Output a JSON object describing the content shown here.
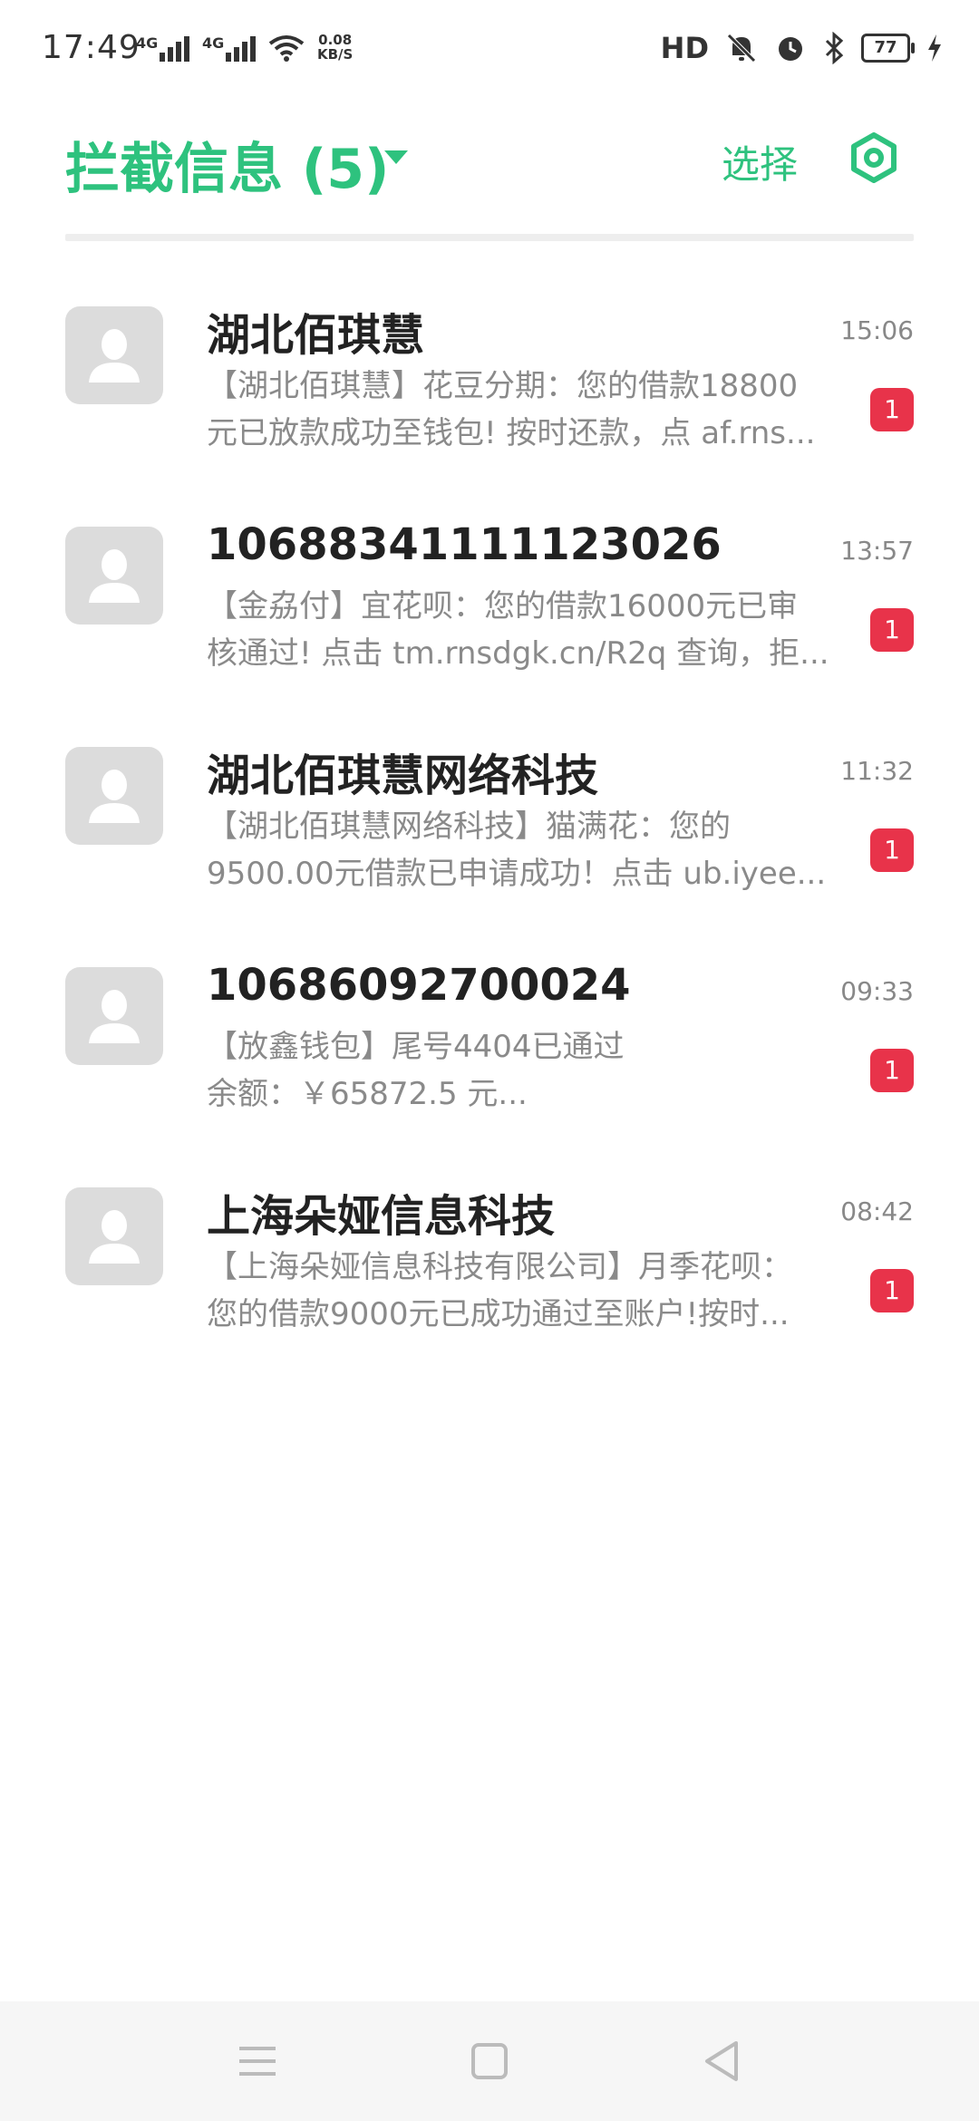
{
  "status_bar": {
    "time": "17:49",
    "network_1": "4G",
    "network_2": "4G",
    "speed_value": "0.08",
    "speed_unit": "KB/S",
    "hd_label": "HD",
    "battery": "77"
  },
  "header": {
    "title": "拦截信息 (5)",
    "select_label": "选择"
  },
  "messages": [
    {
      "sender": "湖北佰琪慧",
      "time": "15:06",
      "preview_line1": "【湖北佰琪慧】花豆分期：您的借款18800",
      "preview_line2": "元已放款成功至钱包! 按时还款，点 af.rns...",
      "badge": "1"
    },
    {
      "sender": "10688341111123026",
      "time": "13:57",
      "preview_line1": "【金劦付】宜花呗：您的借款16000元已审",
      "preview_line2": "核通过! 点击 tm.rnsdgk.cn/R2q 查询，拒...",
      "badge": "1"
    },
    {
      "sender": "湖北佰琪慧网络科技",
      "time": "11:32",
      "preview_line1": "【湖北佰琪慧网络科技】猫满花：您的",
      "preview_line2": "9500.00元借款已申请成功！点击 ub.iyee...",
      "badge": "1"
    },
    {
      "sender": "10686092700024",
      "time": "09:33",
      "preview_line1": "【放鑫钱包】尾号4404已通过",
      "preview_line2": "余额：￥65872.5 元...",
      "badge": "1"
    },
    {
      "sender": "上海朵娅信息科技",
      "time": "08:42",
      "preview_line1": "【上海朵娅信息科技有限公司】月季花呗：",
      "preview_line2": "您的借款9000元已成功通过至账户!按时...",
      "badge": "1"
    }
  ],
  "colors": {
    "accent": "#2ec27e",
    "badge": "#e8334a"
  },
  "icons": {
    "settings": "hexagon-gear-icon",
    "avatar": "person-icon",
    "nav_menu": "menu-icon",
    "nav_home": "home-square-icon",
    "nav_back": "back-triangle-icon"
  }
}
